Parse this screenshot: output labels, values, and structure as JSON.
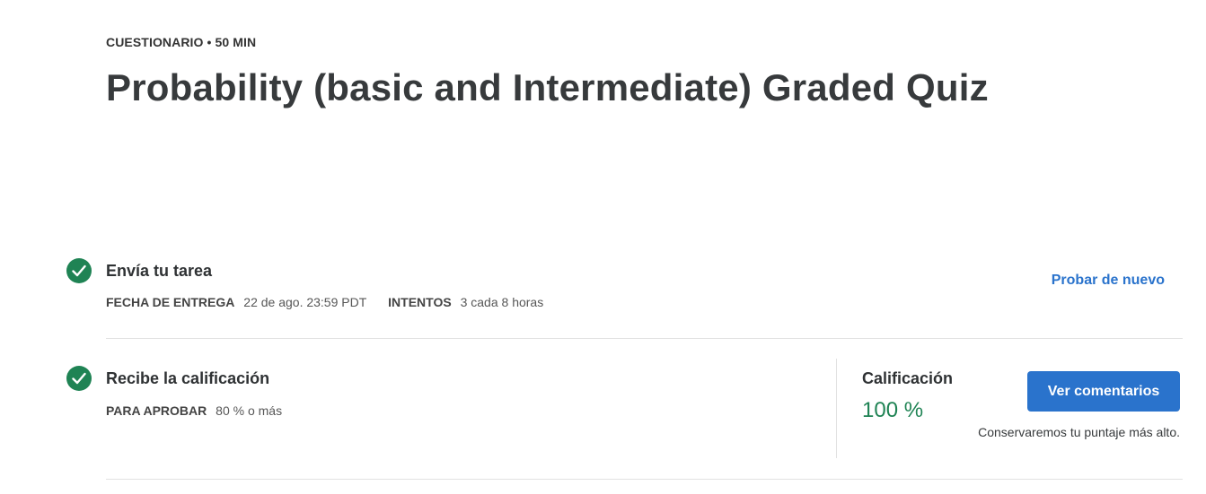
{
  "header": {
    "meta": "CUESTIONARIO • 50 MIN",
    "title": "Probability (basic and Intermediate) Graded Quiz"
  },
  "submit_step": {
    "title": "Envía tu tarea",
    "due_label": "FECHA DE ENTREGA",
    "due_value": "22 de ago. 23:59 PDT",
    "attempts_label": "INTENTOS",
    "attempts_value": "3 cada 8 horas",
    "retry_link": "Probar de nuevo",
    "icon": "check-circle-icon"
  },
  "grade_step": {
    "title": "Recibe la calificación",
    "pass_label": "PARA APROBAR",
    "pass_value": "80 % o más",
    "grade_label": "Calificación",
    "grade_value": "100 %",
    "feedback_button": "Ver comentarios",
    "note": "Conservaremos tu puntaje más alto.",
    "icon": "check-circle-icon"
  },
  "colors": {
    "success": "#1f8354",
    "primary": "#2a73cc",
    "divider": "#e1e1e1"
  }
}
